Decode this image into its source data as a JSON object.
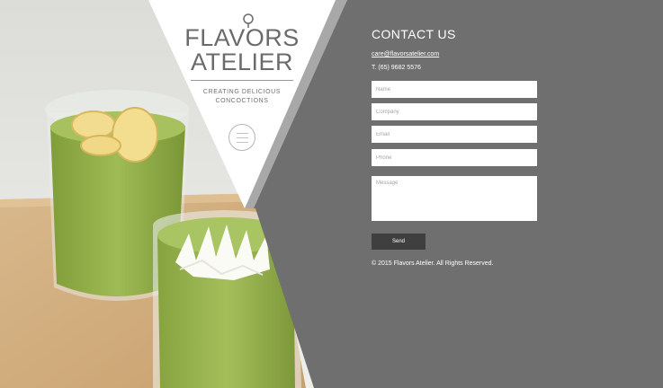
{
  "brand": {
    "logo_line1": "FLAVORS",
    "logo_line2": "ATELIER",
    "tagline_line1": "CREATING DELICIOUS",
    "tagline_line2": "CONCOCTIONS"
  },
  "contact": {
    "title": "CONTACT US",
    "email": "care@flavorsatelier.com",
    "phone": "T. (65) 9682 5576"
  },
  "form": {
    "name_placeholder": "Name",
    "company_placeholder": "Company",
    "email_placeholder": "Email",
    "phone_placeholder": "Phone",
    "message_placeholder": "Message",
    "send_label": "Send"
  },
  "footer": {
    "copyright": "© 2015 Flavors Atelier. All Rights Reserved."
  },
  "colors": {
    "panel": "#6f6f70",
    "button": "#3f3f3f",
    "drink": "#8fae4a"
  },
  "icons": {
    "badge": "lines-badge-icon",
    "pin": "lollipop-icon"
  }
}
